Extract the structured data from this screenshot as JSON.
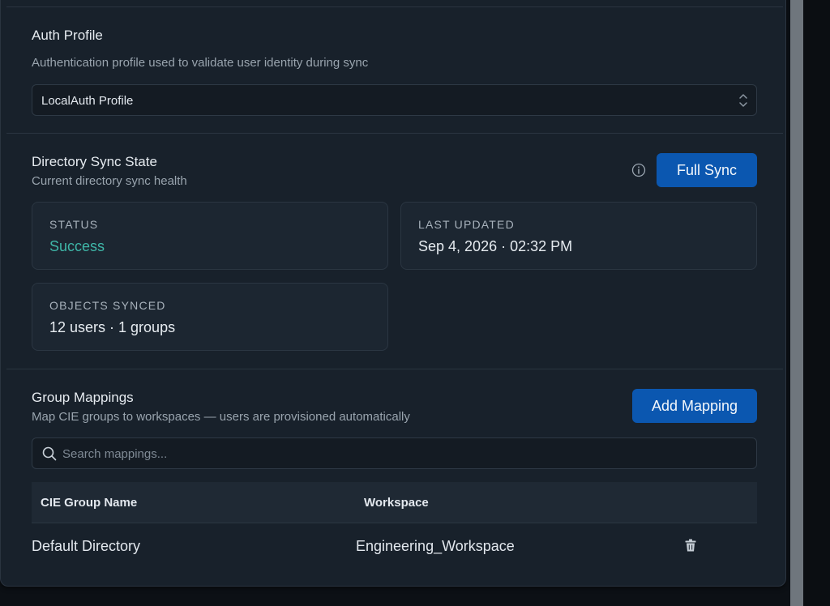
{
  "auth_profile": {
    "title": "Auth Profile",
    "description": "Authentication profile used to validate user identity during sync",
    "selected": "LocalAuth Profile"
  },
  "sync_state": {
    "title": "Directory Sync State",
    "subtitle": "Current directory sync health",
    "full_sync_label": "Full Sync",
    "status": {
      "label": "STATUS",
      "value": "Success",
      "color": "#3fb6a8"
    },
    "last_updated": {
      "label": "LAST UPDATED",
      "value": "Sep 4, 2026 · 02:32 PM"
    },
    "objects_synced": {
      "label": "OBJECTS SYNCED",
      "value": "12 users · 1 groups"
    }
  },
  "group_mappings": {
    "title": "Group Mappings",
    "subtitle": "Map CIE groups to workspaces — users are provisioned automatically",
    "add_label": "Add Mapping",
    "search_placeholder": "Search mappings...",
    "columns": [
      "CIE Group Name",
      "Workspace"
    ],
    "rows": [
      {
        "group": "Default Directory",
        "workspace": "Engineering_Workspace"
      }
    ]
  },
  "colors": {
    "accent": "#0b57b0",
    "success": "#3fb6a8",
    "panel": "#18212b"
  }
}
